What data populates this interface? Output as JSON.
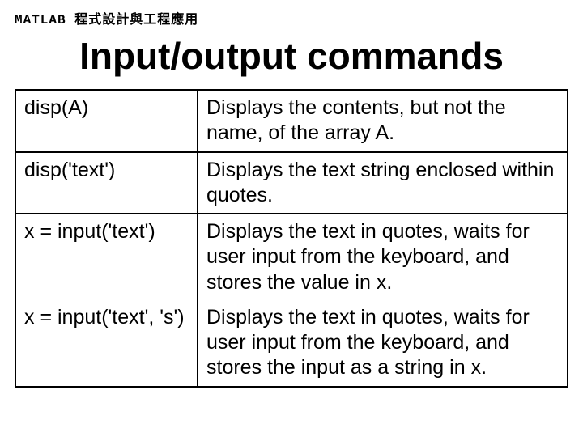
{
  "header": "MATLAB 程式設計與工程應用",
  "title": "Input/output commands",
  "rows": [
    {
      "cmd": "disp(A)",
      "desc": "Displays the contents, but not the name, of the array A."
    },
    {
      "cmd": "disp('text')",
      "desc": "Displays the text string enclosed within quotes."
    },
    {
      "cmd": "x = input('text')",
      "desc": "Displays the text in quotes, waits for user input from the keyboard, and stores the value in x."
    },
    {
      "cmd": "x = input('text', 's')",
      "desc": "Displays the text in quotes, waits for user input from the keyboard, and stores the input as a string in x."
    }
  ]
}
